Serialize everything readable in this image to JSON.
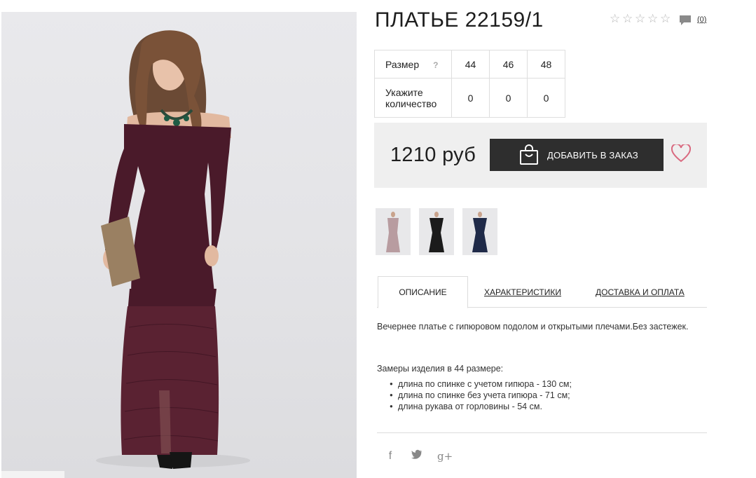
{
  "product": {
    "title": "ПЛАТЬЕ 22159/1",
    "review_count": "(0)",
    "rating_stars": [
      "☆",
      "☆",
      "☆",
      "☆",
      "☆"
    ]
  },
  "size_table": {
    "size_label": "Размер",
    "help_label": "?",
    "sizes": [
      "44",
      "46",
      "48"
    ],
    "qty_label_line1": "Укажите",
    "qty_label_line2": "количество",
    "quantities": [
      "0",
      "0",
      "0"
    ]
  },
  "purchase": {
    "price": "1210 руб",
    "add_to_order_label": "ДОБАВИТЬ В ЗАКАЗ"
  },
  "tabs": [
    {
      "label": "ОПИСАНИЕ",
      "active": true
    },
    {
      "label": "ХАРАКТЕРИСТИКИ",
      "active": false
    },
    {
      "label": "ДОСТАВКА И ОПЛАТА",
      "active": false
    }
  ],
  "description": {
    "text": "Вечернее платье с гипюровом подолом и открытыми плечами.Без застежек.",
    "measures_title": "Замеры изделия в 44 размере:",
    "measures": [
      "длина по спинке с учетом гипюра - 130 см;",
      "длина по спинке без учета гипюра - 71 см;",
      "длина рукава от горловины - 54 см."
    ]
  },
  "social": {
    "facebook": "f",
    "twitter": "🐦",
    "google_plus": "g+"
  },
  "colors": {
    "dress_main": "#4a1a2a",
    "button_bg": "#2e2e2e",
    "heart": "#d9697f",
    "price_box_bg": "#efefef",
    "thumb_variants": [
      "#b89ca0",
      "#1b1b1b",
      "#1f2a48"
    ]
  }
}
